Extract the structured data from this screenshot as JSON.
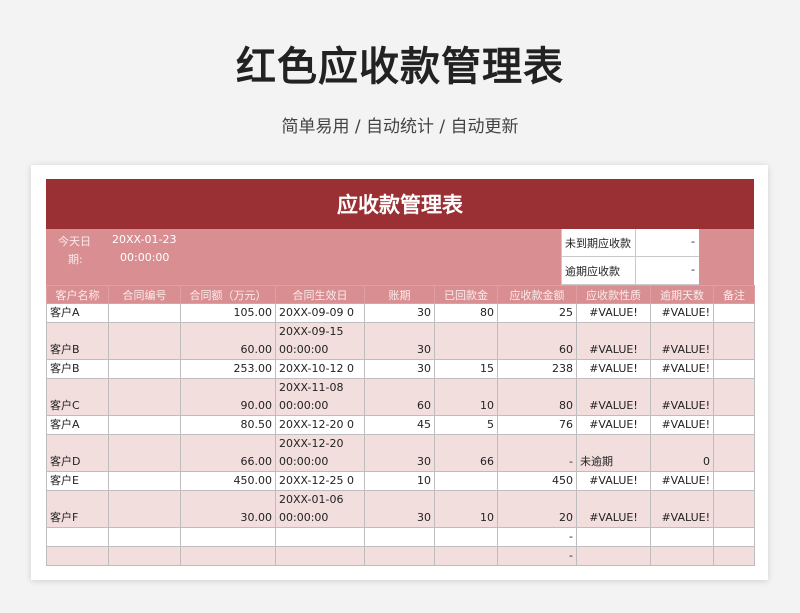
{
  "page": {
    "title": "红色应收款管理表",
    "subtitle": "简单易用 / 自动统计 / 自动更新"
  },
  "sheet": {
    "banner": "应收款管理表",
    "today_label_1": "今天日",
    "today_label_2": "期:",
    "today_date": "20XX-01-23",
    "today_time": "00:00:00",
    "summary": [
      {
        "label": "未到期应收款",
        "value": "-"
      },
      {
        "label": "逾期应收款",
        "value": "-"
      }
    ],
    "headers": [
      "客户名称",
      "合同编号",
      "合同额（万元）",
      "合同生效日",
      "账期",
      "已回款金",
      "应收款金额",
      "应收款性质",
      "逾期天数",
      "备注"
    ],
    "rows": [
      {
        "customer": "客户A",
        "contract_no": "",
        "amount": "105.00",
        "date1": "20XX-09-09 0",
        "date2": "",
        "term": "30",
        "received": "80",
        "receivable": "25",
        "nature": "#VALUE!",
        "overdue": "#VALUE!",
        "note": ""
      },
      {
        "customer": "客户B",
        "contract_no": "",
        "amount": "60.00",
        "date1": "20XX-09-15",
        "date2": "00:00:00",
        "term": "30",
        "received": "",
        "receivable": "60",
        "nature": "#VALUE!",
        "overdue": "#VALUE!",
        "note": ""
      },
      {
        "customer": "客户B",
        "contract_no": "",
        "amount": "253.00",
        "date1": "20XX-10-12 0",
        "date2": "",
        "term": "30",
        "received": "15",
        "receivable": "238",
        "nature": "#VALUE!",
        "overdue": "#VALUE!",
        "note": ""
      },
      {
        "customer": "客户C",
        "contract_no": "",
        "amount": "90.00",
        "date1": "20XX-11-08",
        "date2": "00:00:00",
        "term": "60",
        "received": "10",
        "receivable": "80",
        "nature": "#VALUE!",
        "overdue": "#VALUE!",
        "note": ""
      },
      {
        "customer": "客户A",
        "contract_no": "",
        "amount": "80.50",
        "date1": "20XX-12-20 0",
        "date2": "",
        "term": "45",
        "received": "5",
        "receivable": "76",
        "nature": "#VALUE!",
        "overdue": "#VALUE!",
        "note": ""
      },
      {
        "customer": "客户D",
        "contract_no": "",
        "amount": "66.00",
        "date1": "20XX-12-20",
        "date2": "00:00:00",
        "term": "30",
        "received": "66",
        "receivable": "-",
        "nature": "未逾期",
        "overdue": "0",
        "note": ""
      },
      {
        "customer": "客户E",
        "contract_no": "",
        "amount": "450.00",
        "date1": "20XX-12-25 0",
        "date2": "",
        "term": "10",
        "received": "",
        "receivable": "450",
        "nature": "#VALUE!",
        "overdue": "#VALUE!",
        "note": ""
      },
      {
        "customer": "客户F",
        "contract_no": "",
        "amount": "30.00",
        "date1": "20XX-01-06",
        "date2": "00:00:00",
        "term": "30",
        "received": "10",
        "receivable": "20",
        "nature": "#VALUE!",
        "overdue": "#VALUE!",
        "note": ""
      },
      {
        "customer": "",
        "contract_no": "",
        "amount": "",
        "date1": "",
        "date2": "",
        "term": "",
        "received": "",
        "receivable": "-",
        "nature": "",
        "overdue": "",
        "note": ""
      },
      {
        "customer": "",
        "contract_no": "",
        "amount": "",
        "date1": "",
        "date2": "",
        "term": "",
        "received": "",
        "receivable": "-",
        "nature": "",
        "overdue": "",
        "note": ""
      }
    ]
  },
  "colors": {
    "banner": "#9a3034",
    "header": "#d98f92",
    "pink_row": "#f3dede"
  }
}
